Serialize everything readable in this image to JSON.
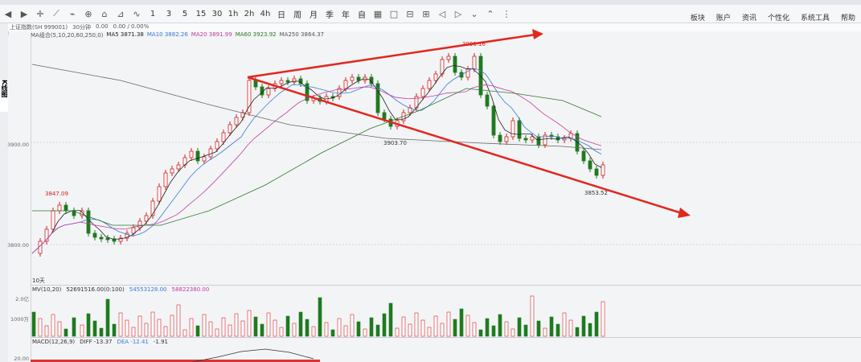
{
  "toolbar": {
    "buttons": [
      "1",
      "3",
      "5",
      "15",
      "30",
      "1h",
      "2h",
      "4h",
      "日",
      "周",
      "月",
      "季",
      "年",
      "自"
    ],
    "icons": [
      "arrow-left-icon",
      "arrow-right-icon",
      "crosshair-icon",
      "draw-line-icon",
      "indicator-icon",
      "zoom-icon",
      "home-icon",
      "pin-icon",
      "chart-line-icon"
    ],
    "nav_icons": [
      "tile-icon",
      "box-icon",
      "collapse-icon",
      "expand-icon",
      "prev-icon",
      "next-icon",
      "move-icon",
      "move-up-icon",
      "more-icon"
    ],
    "right_menu": [
      "板块",
      "账户",
      "资讯",
      "个性化",
      "系统工具",
      "帮助"
    ]
  },
  "sidebar": {
    "tabs": [
      "K线图"
    ]
  },
  "infobar": {
    "items": [
      "上证指数(SH 999001)",
      "30分钟",
      "0.00",
      "0.00 / 0.00%"
    ]
  },
  "ma_legend": {
    "title": "MA组合(5,10,20,60,250,0)",
    "items": [
      {
        "label": "MA5 3871.38",
        "color": "#222222"
      },
      {
        "label": "MA10 3882.26",
        "color": "#3a7bd5"
      },
      {
        "label": "MA20 3891.99",
        "color": "#c040a0"
      },
      {
        "label": "MA60 3923.92",
        "color": "#2a7a2a"
      },
      {
        "label": "MA250 3864.37",
        "color": "#555555"
      }
    ]
  },
  "price_axis": [
    "3900.00",
    "3800.00"
  ],
  "annotations": {
    "high": "3999.16",
    "mid_low": "3903.70",
    "left_low_label": "3847.09",
    "recent_low": "3853.52",
    "bottom_tag": "10天"
  },
  "volume_legend": {
    "items": [
      "MV(10,20)",
      "52691516.00(0:100)",
      "54553128.00",
      "58822380.00"
    ],
    "axis": [
      "2.0亿",
      "1000万"
    ]
  },
  "macd_legend": {
    "items": [
      "MACD(12,26,9)",
      "DIFF -13.37",
      "DEA -12.41",
      "-1.91"
    ],
    "axis": [
      "20.00"
    ]
  },
  "colors": {
    "up": "#d42020",
    "down": "#1f7a1f",
    "trend": "#e0281e"
  }
}
